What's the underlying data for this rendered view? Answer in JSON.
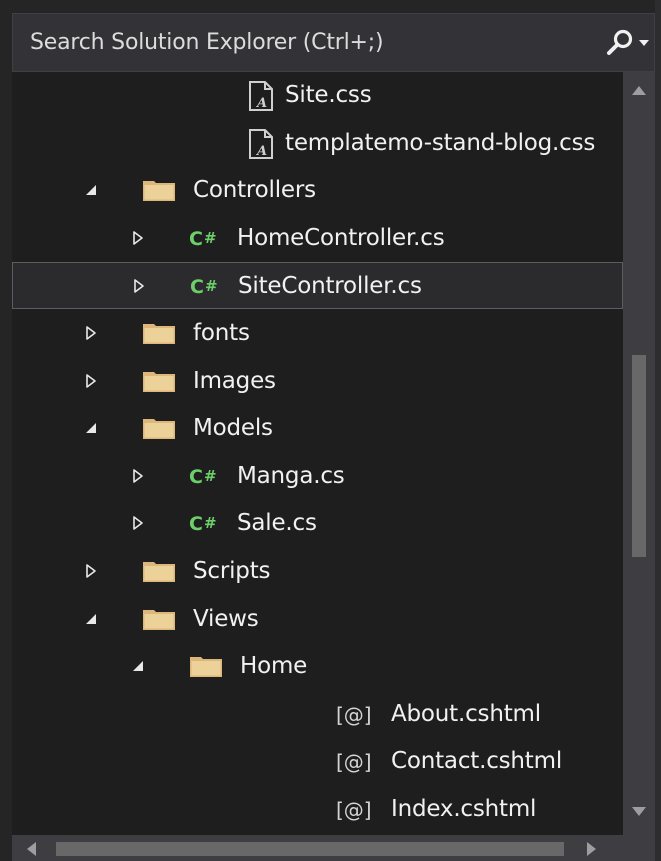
{
  "search": {
    "placeholder": "Search Solution Explorer (Ctrl+;)",
    "icon": "search-icon",
    "dropdown_icon": "chevron-down-icon"
  },
  "colors": {
    "background": "#1e1e1e",
    "folder": "#dcb67a",
    "csharp": "#6ccf6a",
    "text": "#f1f1f1",
    "selection_border": "#5c5c62"
  },
  "tree": {
    "items": [
      {
        "label": "Site.css",
        "icon": "css-file-icon",
        "expander": "none",
        "level": 2
      },
      {
        "label": "templatemo-stand-blog.css",
        "icon": "css-file-icon",
        "expander": "none",
        "level": 2
      },
      {
        "label": "Controllers",
        "icon": "folder-icon",
        "expander": "expanded",
        "level": 1
      },
      {
        "label": "HomeController.cs",
        "icon": "csharp-file-icon",
        "expander": "collapsed",
        "level": 2
      },
      {
        "label": "SiteController.cs",
        "icon": "csharp-file-icon",
        "expander": "collapsed",
        "level": 2,
        "selected": true
      },
      {
        "label": "fonts",
        "icon": "folder-icon",
        "expander": "collapsed",
        "level": 1
      },
      {
        "label": "Images",
        "icon": "folder-icon",
        "expander": "collapsed",
        "level": 1
      },
      {
        "label": "Models",
        "icon": "folder-icon",
        "expander": "expanded",
        "level": 1
      },
      {
        "label": "Manga.cs",
        "icon": "csharp-file-icon",
        "expander": "collapsed",
        "level": 2
      },
      {
        "label": "Sale.cs",
        "icon": "csharp-file-icon",
        "expander": "collapsed",
        "level": 2
      },
      {
        "label": "Scripts",
        "icon": "folder-icon",
        "expander": "collapsed",
        "level": 1
      },
      {
        "label": "Views",
        "icon": "folder-icon",
        "expander": "expanded",
        "level": 1
      },
      {
        "label": "Home",
        "icon": "folder-icon",
        "expander": "expanded",
        "level": 2
      },
      {
        "label": "About.cshtml",
        "icon": "razor-file-icon",
        "expander": "none",
        "level": 3
      },
      {
        "label": "Contact.cshtml",
        "icon": "razor-file-icon",
        "expander": "none",
        "level": 3
      },
      {
        "label": "Index.cshtml",
        "icon": "razor-file-icon",
        "expander": "none",
        "level": 3
      }
    ]
  },
  "icons": {
    "csharp_letter": "C",
    "csharp_hash": "#",
    "razor_glyph": "[@]"
  }
}
